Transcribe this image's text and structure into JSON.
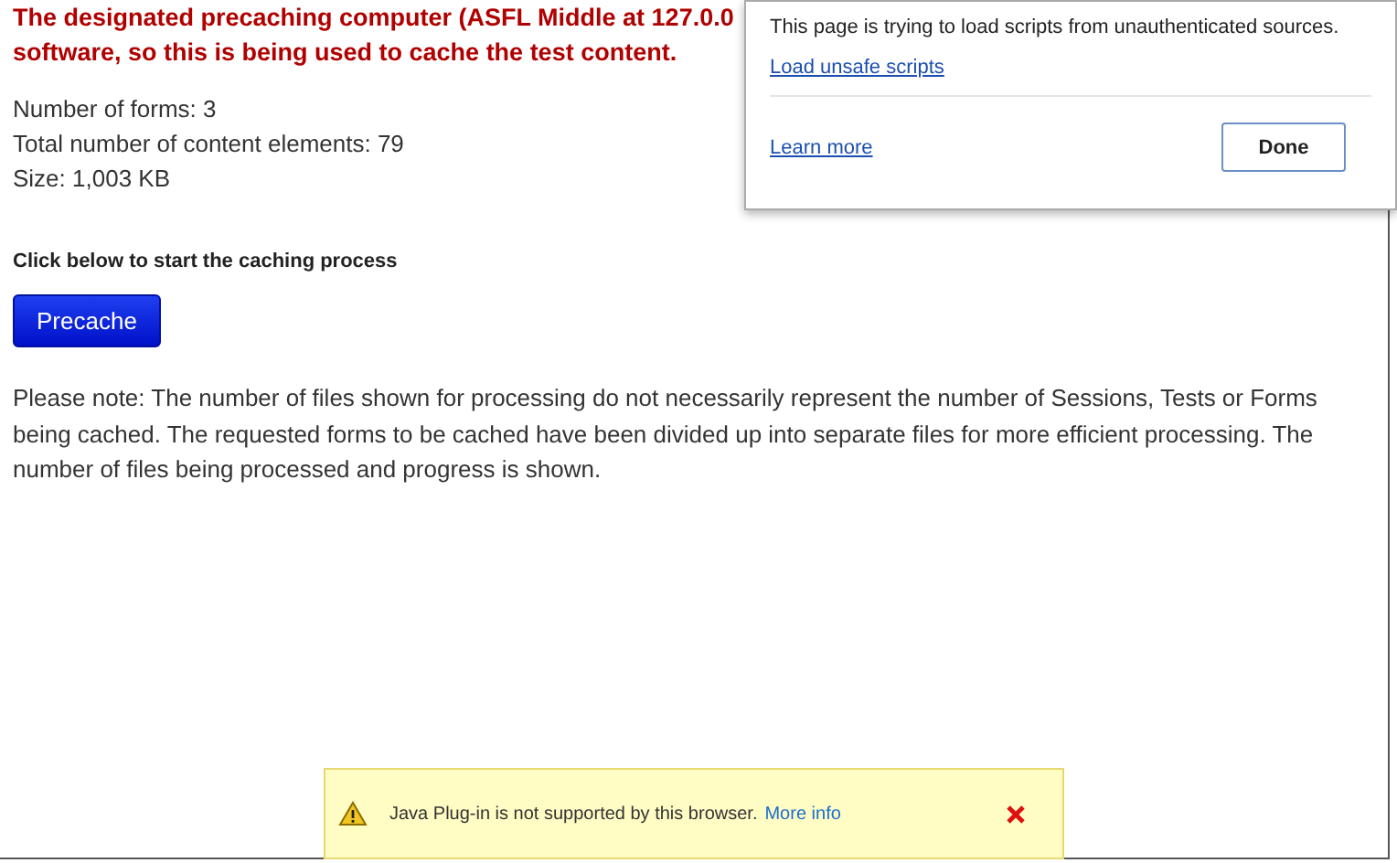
{
  "heading": [
    "The designated precaching computer (ASFL Middle at 127.0.0",
    "software, so this is being used to cache the test content."
  ],
  "stats": [
    "Number of forms: 3",
    "Total number of content elements: 79",
    "Size: 1,003 KB"
  ],
  "instruction": "Click below to start the caching process",
  "precache_button": "Precache",
  "note": "Please note: The number of files shown for processing do not necessarily represent the number of Sessions, Tests or Forms being cached. The requested forms to be cached have been divided up into separate files for more efficient processing. The number of files being processed and progress is shown.",
  "security_popup": {
    "message": "This page is trying to load scripts from unauthenticated sources.",
    "load_link": "Load unsafe scripts",
    "learn_more": "Learn more",
    "done_button": "Done"
  },
  "plugin_bar": {
    "message": "Java Plug-in is not supported by this browser.",
    "link": "More info"
  }
}
